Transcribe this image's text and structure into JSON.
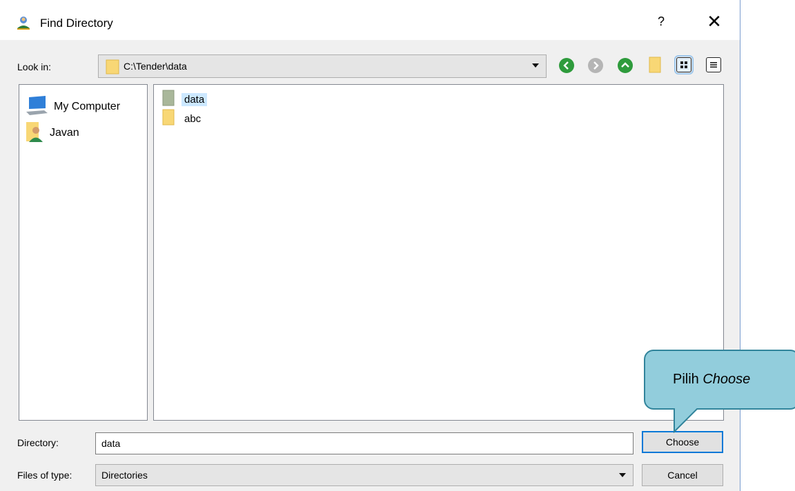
{
  "window": {
    "title": "Find Directory",
    "help_label": "?",
    "close_label": "✕"
  },
  "lookin": {
    "label": "Look in:",
    "path": "C:\\Tender\\data"
  },
  "places": [
    {
      "label": "My Computer",
      "icon": "computer-icon"
    },
    {
      "label": "Javan",
      "icon": "user-folder-icon"
    }
  ],
  "files": [
    {
      "name": "data",
      "selected": true,
      "icon": "folder-icon"
    },
    {
      "name": "abc",
      "selected": false,
      "icon": "folder-icon"
    }
  ],
  "directory": {
    "label": "Directory:",
    "value": "data"
  },
  "filetype": {
    "label": "Files of type:",
    "value": "Directories"
  },
  "buttons": {
    "choose": "Choose",
    "cancel": "Cancel"
  },
  "callout": {
    "prefix": "Pilih ",
    "emphasis": "Choose"
  },
  "colors": {
    "nav_green": "#2e9b3c",
    "nav_gray": "#b5b5b5",
    "folder_yellow": "#f8d775",
    "selection": "#cce8ff",
    "callout_fill": "#92cddc",
    "callout_border": "#31849b",
    "default_button_border": "#0078d7"
  }
}
